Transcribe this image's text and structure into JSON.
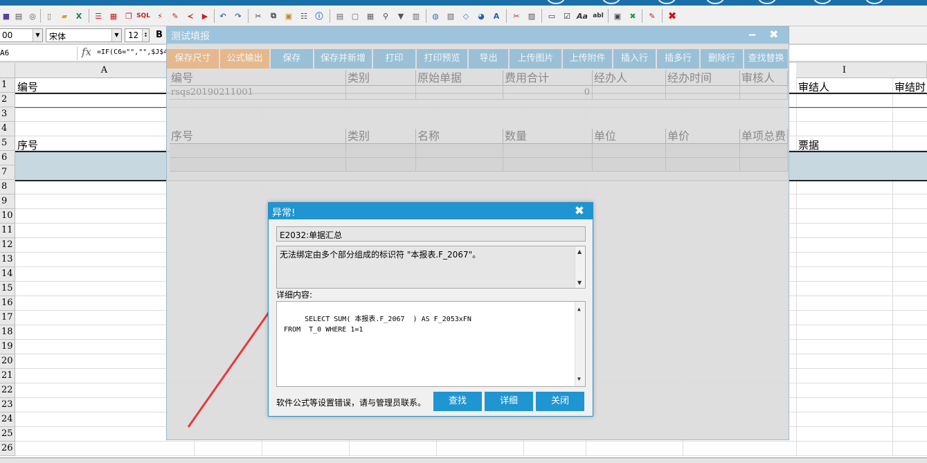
{
  "formatbar": {
    "size_value": "00",
    "font_name": "宋体",
    "font_size": "12",
    "bold_label": "B"
  },
  "formulabar": {
    "cell_ref": "A6",
    "fx_label": "fx",
    "formula": "=IF(C6=\"\",\"\",$J$4"
  },
  "sheet": {
    "columns": [
      "A",
      "I"
    ],
    "rows": [
      "1",
      "2",
      "3",
      "4",
      "5",
      "6",
      "7",
      "8",
      "9",
      "10",
      "11",
      "12",
      "13",
      "14",
      "15",
      "16",
      "17",
      "18",
      "19",
      "20",
      "21",
      "22",
      "23",
      "24",
      "25",
      "26"
    ],
    "cells": {
      "a1": "编号",
      "a5": "序号",
      "i1_left": "审结人",
      "i1_right": "审结时",
      "i5": "票据"
    }
  },
  "form": {
    "title": "测试填报",
    "buttons": [
      "保存尺寸",
      "公式输出",
      "保存",
      "保存并新增",
      "打印",
      "打印预览",
      "导出",
      "上传图片",
      "上传附件",
      "插入行",
      "插多行",
      "删除行",
      "查找替换"
    ],
    "header_table": {
      "columns": [
        "编号",
        "类别",
        "原始单据",
        "费用合计",
        "经办人",
        "经办时间",
        "审核人"
      ],
      "row": [
        "rsqs20190211001",
        "",
        "",
        "0",
        "",
        "",
        ""
      ]
    },
    "detail_table": {
      "columns": [
        "序号",
        "类别",
        "名称",
        "数量",
        "单位",
        "单价",
        "单项总费"
      ]
    }
  },
  "dialog": {
    "title": "异常!",
    "close_glyph": "✖",
    "error_code": "E2032:单据汇总",
    "message": "无法绑定由多个部分组成的标识符 \"本报表.F_2067\"。",
    "detail_label": "详细内容:",
    "detail_text": "SELECT SUM( 本报表.F_2067  ) AS F_2053xFN\n FROM  T_0 WHERE 1=1",
    "footer_text": "软件公式等设置错误，请与管理员联系。",
    "buttons": {
      "search": "查找",
      "detail": "详细",
      "close": "关闭"
    }
  },
  "colors": {
    "dialog_accent": "#1f95d1",
    "form_button": "#9ac0d6",
    "form_button_active": "#e6b88c",
    "annotation_arrow": "#e8383a"
  }
}
